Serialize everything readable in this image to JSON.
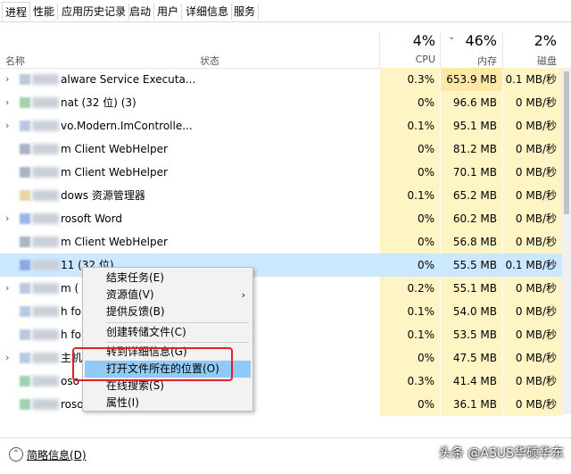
{
  "tabs": [
    "进程",
    "性能",
    "应用历史记录",
    "启动",
    "用户",
    "详细信息",
    "服务"
  ],
  "header": {
    "name_label": "名称",
    "status_label": "状态",
    "cpu_pct": "4%",
    "cpu_label": "CPU",
    "mem_pct": "46%",
    "mem_label": "内存",
    "disk_pct": "2%",
    "disk_label": "磁盘"
  },
  "rows": [
    {
      "name": "alware Service Executa...",
      "cpu": "0.3%",
      "mem": "653.9 MB",
      "disk": "0.1 MB/秒"
    },
    {
      "name": "nat (32 位) (3)",
      "cpu": "0%",
      "mem": "96.6 MB",
      "disk": "0 MB/秒"
    },
    {
      "name": "vo.Modern.ImControlle...",
      "cpu": "0.1%",
      "mem": "95.1 MB",
      "disk": "0 MB/秒"
    },
    {
      "name": "m Client WebHelper",
      "cpu": "0%",
      "mem": "81.2 MB",
      "disk": "0 MB/秒"
    },
    {
      "name": "m Client WebHelper",
      "cpu": "0%",
      "mem": "70.1 MB",
      "disk": "0 MB/秒"
    },
    {
      "name": "dows 资源管理器",
      "cpu": "0.1%",
      "mem": "65.2 MB",
      "disk": "0 MB/秒"
    },
    {
      "name": "rosoft Word",
      "cpu": "0%",
      "mem": "60.2 MB",
      "disk": "0 MB/秒"
    },
    {
      "name": "m Client WebHelper",
      "cpu": "0%",
      "mem": "56.8 MB",
      "disk": "0 MB/秒"
    },
    {
      "name": "11 (32 位)",
      "cpu": "0%",
      "mem": "55.5 MB",
      "disk": "0.1 MB/秒"
    },
    {
      "name": "m (",
      "cpu": "0.2%",
      "mem": "55.1 MB",
      "disk": "0 MB/秒"
    },
    {
      "name": "h fo",
      "cpu": "0.1%",
      "mem": "54.0 MB",
      "disk": "0 MB/秒"
    },
    {
      "name": "h fo",
      "cpu": "0.1%",
      "mem": "53.5 MB",
      "disk": "0 MB/秒"
    },
    {
      "name": "主机",
      "cpu": "0%",
      "mem": "47.5 MB",
      "disk": "0 MB/秒"
    },
    {
      "name": "oso",
      "cpu": "0.3%",
      "mem": "41.4 MB",
      "disk": "0 MB/秒"
    },
    {
      "name": "rosoft Edge",
      "cpu": "0%",
      "mem": "36.1 MB",
      "disk": "0 MB/秒"
    }
  ],
  "menu": {
    "end_task": "结束任务(E)",
    "resource_values": "资源值(V)",
    "feedback": "提供反馈(B)",
    "create_dump": "创建转储文件(C)",
    "goto_details": "转到详细信息(G)",
    "open_location": "打开文件所在的位置(O)",
    "search_online": "在线搜索(S)",
    "properties": "属性(I)"
  },
  "footer": {
    "brief": "简略信息(D)",
    "watermark": "头条 @ASUS华硕华东"
  }
}
